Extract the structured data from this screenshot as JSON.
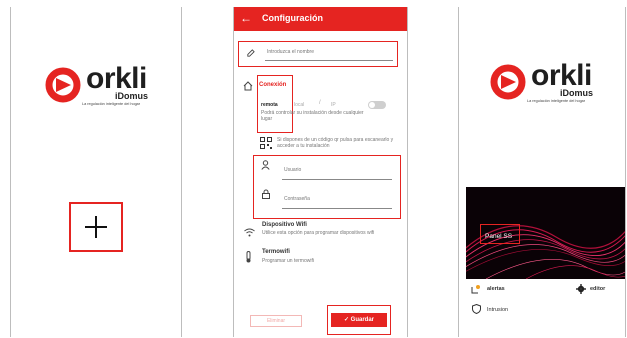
{
  "brand": {
    "wordmark": "orkli",
    "product": "iDomus",
    "tagline": "La regulación inteligente del hogar",
    "accent": "#e52421"
  },
  "screen1": {
    "add_icon": "plus-icon"
  },
  "screen2": {
    "app_bar": {
      "title": "Configuración",
      "back_icon": "arrow-left-icon"
    },
    "name_field": {
      "placeholder": "Introduzca el nombre",
      "icon": "pencil-icon"
    },
    "connection": {
      "title": "Conexión",
      "option_remote": "remota",
      "option_local": "local",
      "separator": "/",
      "option_ip": "IP",
      "description": "Podrá controlar su instalación desde cualquier lugar",
      "qr_text": "Si dispones de un código qr pulsa para escanearlo y acceder a tu instalación"
    },
    "user_field": {
      "placeholder": "Usuario",
      "icon": "person-icon"
    },
    "password_field": {
      "placeholder": "Contraseña",
      "icon": "lock-icon"
    },
    "wifi": {
      "title": "Dispositivo Wifi",
      "description": "Utilice esta opción para programar dispositivos wifi"
    },
    "termowifi": {
      "title": "Termowifi",
      "description": "Programar un termowifi"
    },
    "delete_label": "Eliminar",
    "save_label": "Guardar"
  },
  "screen3": {
    "panel_name": "Panel SS",
    "alerts_label": "alertas",
    "editor_label": "editor",
    "intrusion_label": "Intrusion"
  }
}
